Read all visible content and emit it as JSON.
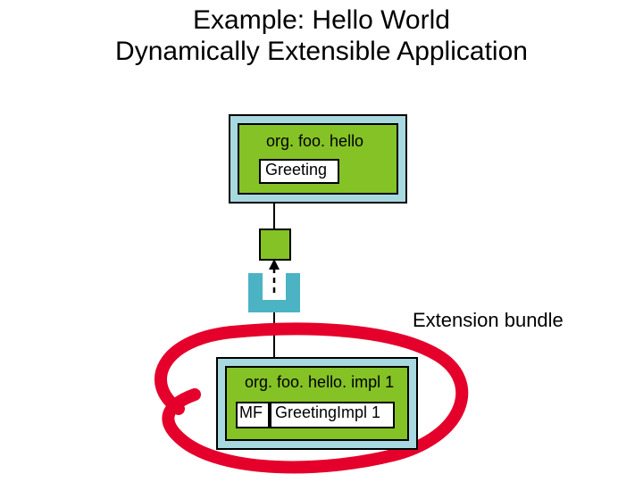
{
  "title_line1": "Example: Hello World",
  "title_line2": "Dynamically Extensible Application",
  "top_box": {
    "pkg": "org. foo. hello",
    "cls": "Greeting"
  },
  "bottom_box": {
    "pkg": "org. foo. hello. impl 1",
    "mf": "MF",
    "cls": "GreetingImpl 1"
  },
  "ext_label": "Extension bundle"
}
